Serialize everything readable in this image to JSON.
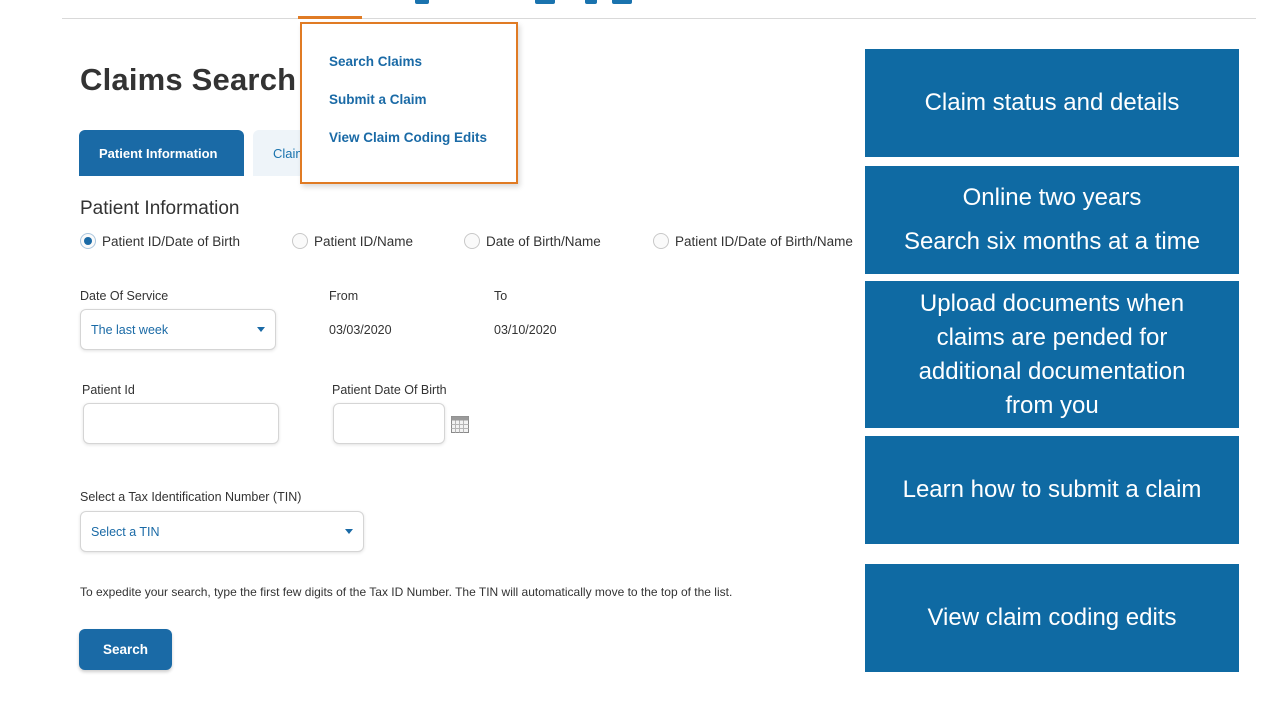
{
  "page": {
    "title": "Claims Search"
  },
  "tabs": [
    {
      "label": "Patient Information",
      "active": true
    },
    {
      "label": "Claim",
      "active": false
    }
  ],
  "dropdown_menu": {
    "items": [
      "Search Claims",
      "Submit a Claim",
      "View Claim Coding Edits"
    ]
  },
  "patient_info": {
    "section_title": "Patient Information",
    "search_options": [
      {
        "label": "Patient ID/Date of Birth",
        "selected": true
      },
      {
        "label": "Patient ID/Name",
        "selected": false
      },
      {
        "label": "Date of Birth/Name",
        "selected": false
      },
      {
        "label": "Patient ID/Date of Birth/Name",
        "selected": false
      }
    ]
  },
  "date_of_service": {
    "label": "Date Of Service",
    "selected": "The last week",
    "from_label": "From",
    "from_value": "03/03/2020",
    "to_label": "To",
    "to_value": "03/10/2020"
  },
  "patient_fields": {
    "patient_id_label": "Patient Id",
    "patient_id_value": "",
    "dob_label": "Patient Date Of Birth",
    "dob_value": ""
  },
  "tin": {
    "label": "Select a Tax Identification Number (TIN)",
    "selected": "Select a TIN",
    "hint": "To expedite your search, type the first few digits of the Tax ID Number. The TIN will automatically move to the top of the list."
  },
  "actions": {
    "search_label": "Search"
  },
  "callouts": [
    {
      "lines": [
        "Claim status and details"
      ]
    },
    {
      "lines": [
        "Online two years",
        "Search six months at a time"
      ]
    },
    {
      "lines": [
        "Upload documents when",
        "claims are pended for",
        "additional documentation",
        "from you"
      ]
    },
    {
      "lines": [
        "Learn how to submit a claim"
      ]
    },
    {
      "lines": [
        "View claim coding edits"
      ]
    }
  ],
  "colors": {
    "primary_blue": "#1a6aa6",
    "callout_blue": "#0f6aa3",
    "highlight_orange": "#e07b24"
  },
  "icons": {
    "calendar": "calendar-icon",
    "dropdown_caret": "chevron-down-icon"
  }
}
